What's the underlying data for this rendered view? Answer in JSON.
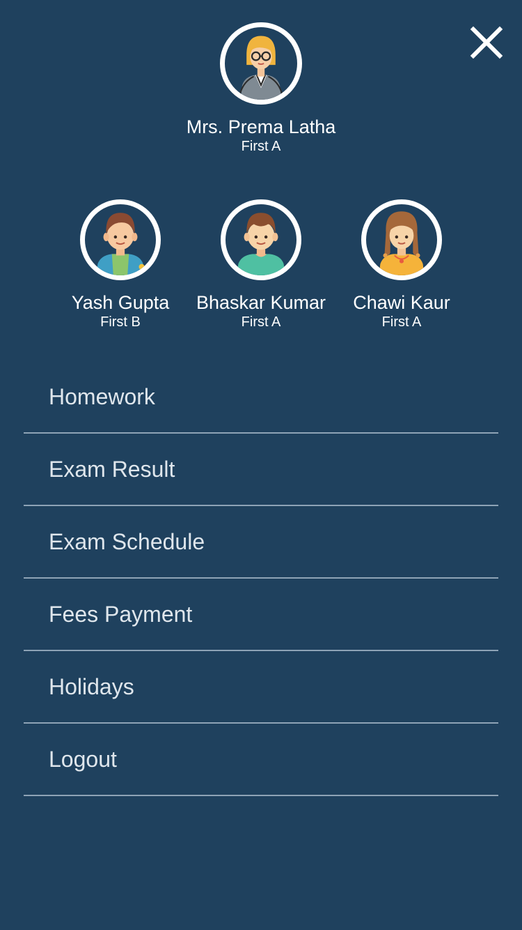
{
  "close": {
    "icon": "close-icon"
  },
  "teacher": {
    "name": "Mrs. Prema Latha",
    "class": "First A",
    "avatar_icon": "teacher-avatar-icon"
  },
  "children": [
    {
      "name": "Yash Gupta",
      "class": "First B",
      "avatar_icon": "boy-avatar-icon"
    },
    {
      "name": "Bhaskar Kumar",
      "class": "First A",
      "avatar_icon": "boy-avatar-icon"
    },
    {
      "name": "Chawi Kaur",
      "class": "First A",
      "avatar_icon": "girl-avatar-icon"
    }
  ],
  "menu": [
    {
      "label": "Homework"
    },
    {
      "label": "Exam Result"
    },
    {
      "label": "Exam Schedule"
    },
    {
      "label": "Fees Payment"
    },
    {
      "label": "Holidays"
    },
    {
      "label": "Logout"
    }
  ],
  "colors": {
    "background": "#1f415e",
    "divider": "#8ea3b6",
    "menu_text": "#dfe6ec"
  }
}
